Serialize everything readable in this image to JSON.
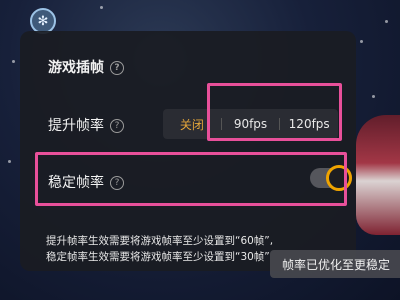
{
  "panel": {
    "title": "游戏插帧",
    "help_glyph": "?",
    "rows": {
      "framerate_boost": {
        "label": "提升帧率",
        "options": [
          "关闭",
          "90fps",
          "120fps"
        ],
        "selected": "关闭"
      },
      "stable_framerate": {
        "label": "稳定帧率",
        "enabled": true
      }
    },
    "note_line1": "提升帧率生效需要将游戏帧率至少设置到“60帧”,",
    "note_line2": "稳定帧率生效需要将游戏帧率至少设置到“30帧”"
  },
  "toast": "帧率已优化至更稳定",
  "colors": {
    "accent": "#e2a53a",
    "toggle_ring": "#f0a400",
    "highlight": "#e8509a",
    "panel_bg": "#1a1c22"
  },
  "icons": {
    "floating_button": "gear-icon",
    "help": "question-circle-icon"
  }
}
